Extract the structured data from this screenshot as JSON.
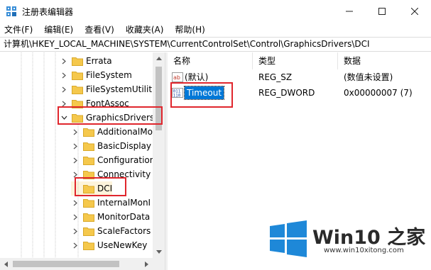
{
  "window": {
    "title": "注册表编辑器",
    "icon": "regedit-icon",
    "controls": [
      "minimize-icon",
      "maximize-icon",
      "close-icon"
    ]
  },
  "menu": [
    "文件(F)",
    "编辑(E)",
    "查看(V)",
    "收藏夹(A)",
    "帮助(H)"
  ],
  "address": "计算机\\HKEY_LOCAL_MACHINE\\SYSTEM\\CurrentControlSet\\Control\\GraphicsDrivers\\DCI",
  "tree": {
    "items": [
      {
        "label": "Errata",
        "state": "collapsed"
      },
      {
        "label": "FileSystem",
        "state": "collapsed"
      },
      {
        "label": "FileSystemUtiliti",
        "state": "collapsed"
      },
      {
        "label": "FontAssoc",
        "state": "collapsed"
      },
      {
        "label": "GraphicsDrivers",
        "state": "expanded"
      },
      {
        "label": "AdditionalMo",
        "state": "collapsed"
      },
      {
        "label": "BasicDisplay",
        "state": "collapsed"
      },
      {
        "label": "Configuration",
        "state": "collapsed"
      },
      {
        "label": "Connectivity",
        "state": "collapsed"
      },
      {
        "label": "DCI",
        "state": "leaf"
      },
      {
        "label": "InternalMonI",
        "state": "collapsed"
      },
      {
        "label": "MonitorData",
        "state": "collapsed"
      },
      {
        "label": "ScaleFactors",
        "state": "collapsed"
      },
      {
        "label": "UseNewKey",
        "state": "collapsed"
      }
    ]
  },
  "list": {
    "columns": [
      "名称",
      "类型",
      "数据"
    ],
    "rows": [
      {
        "name": "(默认)",
        "type": "REG_SZ",
        "data": "(数值未设置)",
        "icon": "string-value-icon"
      },
      {
        "name": "Timeout",
        "type": "REG_DWORD",
        "data": "0x00000007 (7)",
        "icon": "binary-value-icon",
        "selected": true
      }
    ]
  },
  "highlight_color": "#e0262d",
  "selection_color": "#0078d7",
  "folder_color": "#f5c84c",
  "watermark": {
    "brand": "Win10 之家",
    "url": "www.win10xitong.com",
    "logo_color": "#1e88d8"
  }
}
